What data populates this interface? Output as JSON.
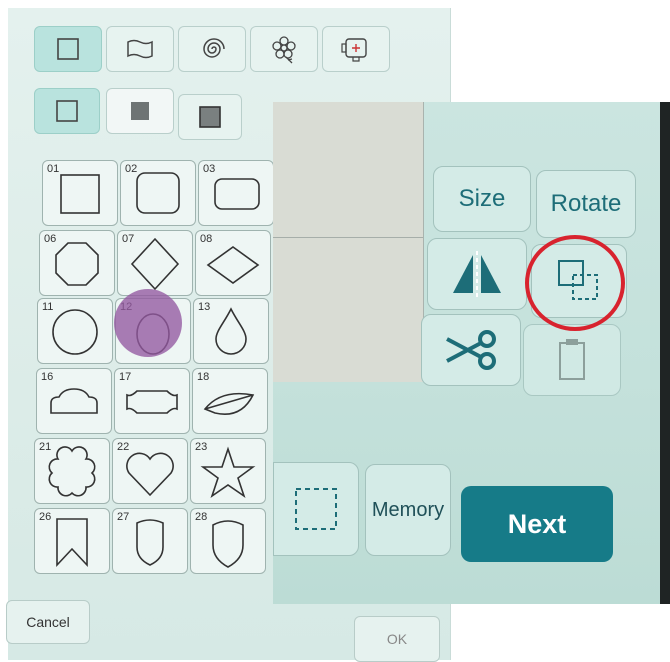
{
  "left_panel": {
    "category_tabs": [
      {
        "icon": "square-shape-icon"
      },
      {
        "icon": "flag-shape-icon"
      },
      {
        "icon": "spiral-icon"
      },
      {
        "icon": "flower-icon"
      },
      {
        "icon": "embroidery-frame-icon"
      }
    ],
    "fill_options": [
      {
        "icon": "outline-square-icon"
      },
      {
        "icon": "filled-square-icon"
      },
      {
        "icon": "bordered-filled-square-icon"
      }
    ],
    "shapes": [
      {
        "num": "01",
        "shape": "square"
      },
      {
        "num": "02",
        "shape": "rounded-square"
      },
      {
        "num": "03",
        "shape": "rounded-rectangle"
      },
      {
        "num": "06",
        "shape": "octagon"
      },
      {
        "num": "07",
        "shape": "diamond"
      },
      {
        "num": "08",
        "shape": "wide-diamond"
      },
      {
        "num": "11",
        "shape": "circle"
      },
      {
        "num": "12",
        "shape": "oval"
      },
      {
        "num": "13",
        "shape": "teardrop"
      },
      {
        "num": "16",
        "shape": "cloud-banner"
      },
      {
        "num": "17",
        "shape": "label"
      },
      {
        "num": "18",
        "shape": "leaf"
      },
      {
        "num": "21",
        "shape": "flower"
      },
      {
        "num": "22",
        "shape": "heart"
      },
      {
        "num": "23",
        "shape": "star"
      },
      {
        "num": "26",
        "shape": "bookmark"
      },
      {
        "num": "27",
        "shape": "shield"
      },
      {
        "num": "28",
        "shape": "badge-shield"
      }
    ],
    "cancel_label": "Cancel",
    "ok_label": "OK"
  },
  "right_panel": {
    "size_label": "Size",
    "rotate_label": "Rotate",
    "memory_label": "Memory",
    "next_label": "Next"
  },
  "colors": {
    "accent": "#167b88",
    "highlight": "#9458a0",
    "annotation": "#d8232e"
  }
}
